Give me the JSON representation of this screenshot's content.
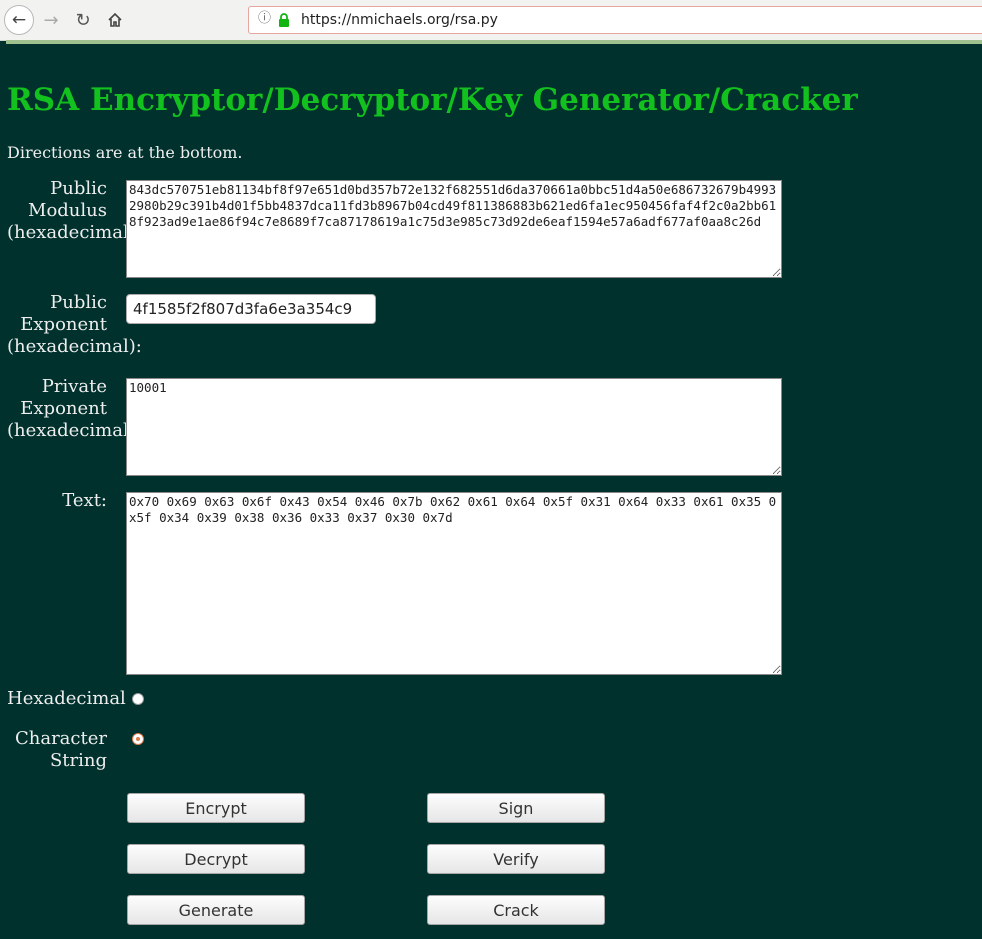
{
  "browser": {
    "url": "https://nmichaels.org/rsa.py"
  },
  "page": {
    "title": "RSA Encryptor/Decryptor/Key Generator/Cracker",
    "directions": "Directions are at the bottom."
  },
  "form": {
    "public_modulus_label": "Public Modulus (hexadecimal):",
    "public_modulus_value": "843dc570751eb81134bf8f97e651d0bd357b72e132f682551d6da370661a0bbc51d4a50e686732679b49932980b29c391b4d01f5bb4837dca11fd3b8967b04cd49f811386883b621ed6fa1ec950456faf4f2c0a2bb618f923ad9e1ae86f94c7e8689f7ca87178619a1c75d3e985c73d92de6eaf1594e57a6adf677af0aa8c26d",
    "public_exponent_label": "Public Exponent (hexadecimal):",
    "public_exponent_value": "4f1585f2f807d3fa6e3a354c9",
    "private_exponent_label": "Private Exponent (hexadecimal):",
    "private_exponent_value": "10001",
    "text_label": "Text:",
    "text_value": "0x70 0x69 0x63 0x6f 0x43 0x54 0x46 0x7b 0x62 0x61 0x64 0x5f 0x31 0x64 0x33 0x61 0x35 0x5f 0x34 0x39 0x38 0x36 0x33 0x37 0x30 0x7d",
    "radio_hex_label": "Hexadecimal",
    "radio_char_label": "Character String",
    "selected_format": "Character String"
  },
  "buttons": {
    "encrypt": "Encrypt",
    "sign": "Sign",
    "decrypt": "Decrypt",
    "verify": "Verify",
    "generate": "Generate",
    "crack": "Crack"
  },
  "colors": {
    "background": "#00312d",
    "title": "#12c11d",
    "text": "#eeeeee",
    "radio_selected": "#e07a4c"
  }
}
